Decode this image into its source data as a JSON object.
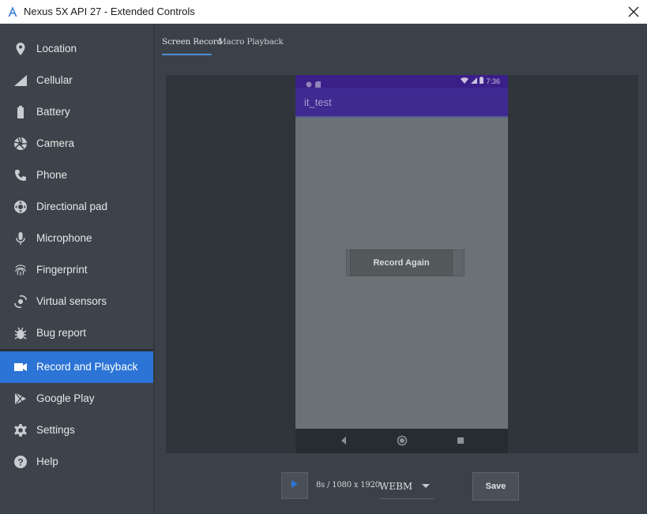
{
  "window": {
    "title": "Nexus 5X API 27 - Extended Controls",
    "close_icon": "close-icon"
  },
  "sidebar": {
    "items": [
      {
        "label": "Location",
        "icon": "location-pin-icon"
      },
      {
        "label": "Cellular",
        "icon": "cellular-signal-icon"
      },
      {
        "label": "Battery",
        "icon": "battery-icon"
      },
      {
        "label": "Camera",
        "icon": "camera-aperture-icon"
      },
      {
        "label": "Phone",
        "icon": "phone-icon"
      },
      {
        "label": "Directional pad",
        "icon": "directional-pad-icon"
      },
      {
        "label": "Microphone",
        "icon": "microphone-icon"
      },
      {
        "label": "Fingerprint",
        "icon": "fingerprint-icon"
      },
      {
        "label": "Virtual sensors",
        "icon": "virtual-sensors-icon"
      },
      {
        "label": "Bug report",
        "icon": "bug-icon"
      },
      {
        "label": "Record and Playback",
        "icon": "video-camera-icon",
        "active": true
      },
      {
        "label": "Google Play",
        "icon": "google-play-icon"
      },
      {
        "label": "Settings",
        "icon": "gear-icon"
      },
      {
        "label": "Help",
        "icon": "help-icon"
      }
    ]
  },
  "main": {
    "tabs": [
      {
        "label": "Screen Record",
        "active": true
      },
      {
        "label": "Macro Playback",
        "active": false
      }
    ],
    "phone": {
      "time": "7:36",
      "app_title": "it_test",
      "record_button_label": "Record Again"
    },
    "controls": {
      "duration": "8s / 1080 x 1920",
      "format": "WEBM",
      "save_label": "Save"
    }
  },
  "colors": {
    "accent": "#2c74d5",
    "sidebar_bg": "#3d434a",
    "main_bg": "#3b4148",
    "phone_status": "#3a1f88",
    "phone_appbar": "#3f2a92"
  }
}
